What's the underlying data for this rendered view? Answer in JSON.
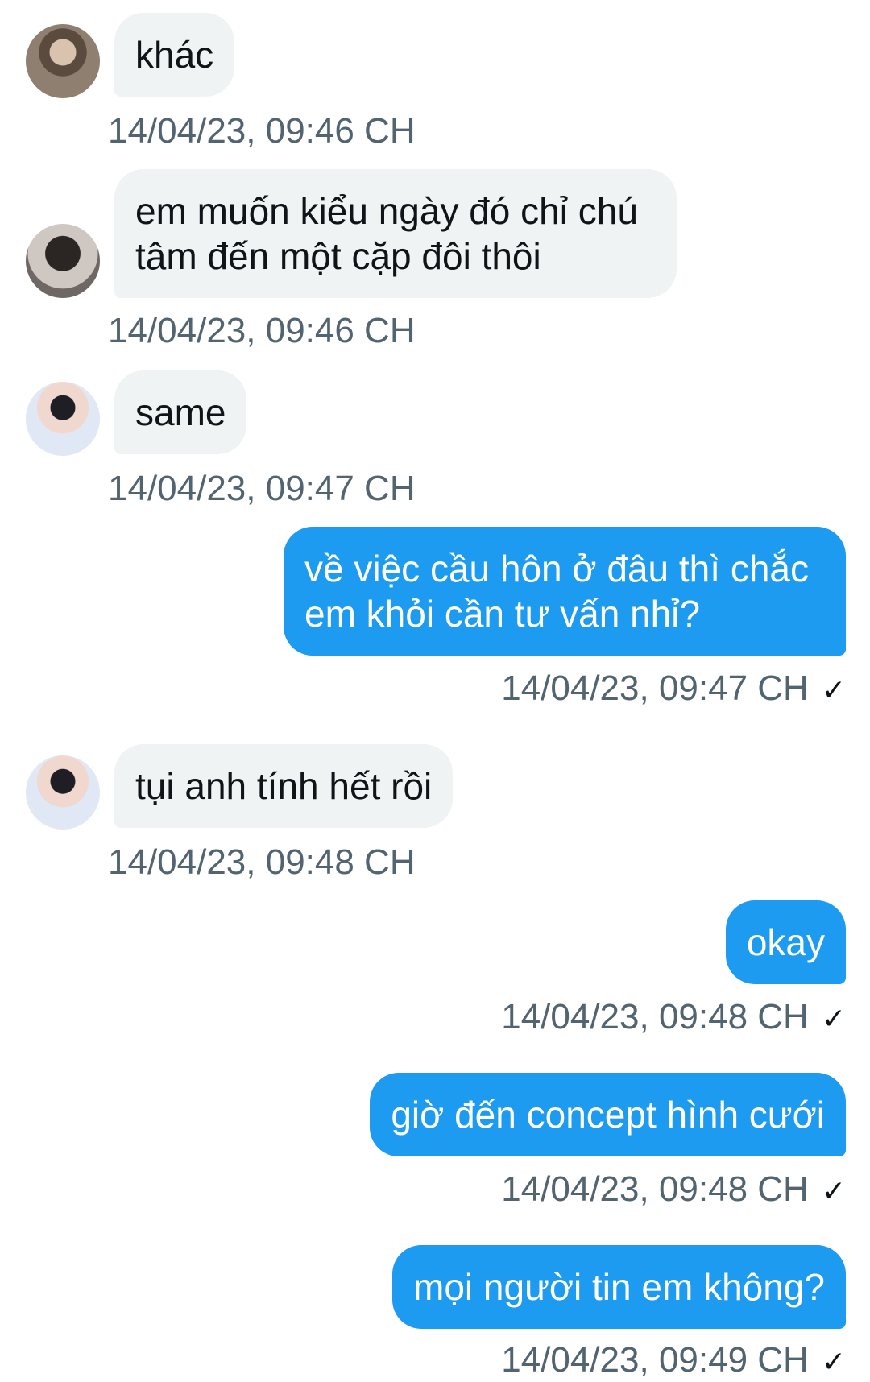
{
  "messages": [
    {
      "id": "m1",
      "direction": "in",
      "avatar": "avatar-user-1",
      "text": "khác",
      "time": "14/04/23, 09:46 CH"
    },
    {
      "id": "m2",
      "direction": "in",
      "avatar": "avatar-user-2",
      "text": "em muốn kiểu ngày đó chỉ chú\ntâm đến một cặp đôi thôi",
      "time": "14/04/23, 09:46 CH"
    },
    {
      "id": "m3",
      "direction": "in",
      "avatar": "avatar-user-3",
      "text": "same",
      "time": "14/04/23, 09:47 CH"
    },
    {
      "id": "m4",
      "direction": "out",
      "text": "về việc cầu hôn ở đâu thì chắc\nem khỏi cần tư vấn nhỉ?",
      "time": "14/04/23, 09:47 CH",
      "status": "✓"
    },
    {
      "id": "m5",
      "direction": "in",
      "avatar": "avatar-user-3",
      "text": "tụi anh tính hết rồi",
      "time": "14/04/23, 09:48 CH"
    },
    {
      "id": "m6",
      "direction": "out",
      "text": "okay",
      "time": "14/04/23, 09:48 CH",
      "status": "✓"
    },
    {
      "id": "m7",
      "direction": "out",
      "text": "giờ đến concept hình cưới",
      "time": "14/04/23, 09:48 CH",
      "status": "✓"
    },
    {
      "id": "m8",
      "direction": "out",
      "text": "mọi người tin em không?",
      "time": "14/04/23, 09:49 CH",
      "status": "✓"
    }
  ],
  "colors": {
    "outgoing_bubble": "#1d9bf0",
    "incoming_bubble": "#eff3f4",
    "timestamp": "#536471"
  }
}
